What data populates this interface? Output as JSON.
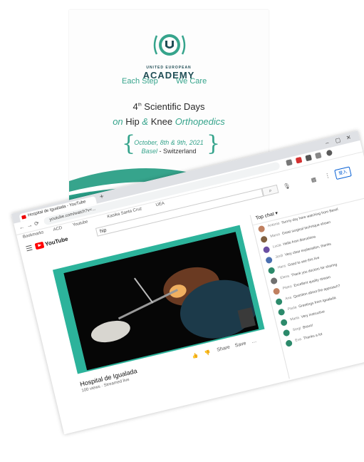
{
  "poster": {
    "logo_line1": "UNITED EUROPEAN",
    "logo_line2": "ACADEMY",
    "tagline_left": "Each Step",
    "tagline_right": "We Care",
    "title_line1_prefix": "4",
    "title_line1_sup": "th",
    "title_line1_rest": " Scientific Days",
    "title_line2_on": "on ",
    "title_line2_hip": "Hip ",
    "title_line2_amp": "& ",
    "title_line2_knee": "Knee ",
    "title_line2_ortho": "Orthopedics",
    "date_line1": "October, 8th & 9th, 2021",
    "date_line2_city": "Basel",
    "date_line2_rest": " - Switzerland",
    "colors": {
      "accent": "#36a48c",
      "navy": "#1f4d55"
    }
  },
  "browser": {
    "tab_title": "Hospital de Igualada - YouTube",
    "url": "youtube.com/watch?v=...",
    "bookmarks": [
      "Bookmarks",
      "ACD",
      "Youtube",
      "Kasika Santa Cruz",
      "UEA"
    ],
    "youtube": {
      "logo_text": "YouTube",
      "search_value": "hip",
      "login_label": "登入",
      "video_title": "Hospital de Igualada",
      "video_meta": "100 views · Streamed live",
      "actions": [
        "👍",
        "👎",
        "Share",
        "Save",
        "…"
      ],
      "chat_header": "Top chat ▾",
      "chat": [
        {
          "author": "Antonio",
          "text": "Sunny day here watching from Basel",
          "color": "#c08060"
        },
        {
          "author": "Marco",
          "text": "Great surgical technique shown",
          "color": "#806040"
        },
        {
          "author": "Lucia",
          "text": "Hello from Barcelona",
          "color": "#6a4fa3"
        },
        {
          "author": "Jordi",
          "text": "Very clear explanation, thanks",
          "color": "#4a6fb0"
        },
        {
          "author": "Hans",
          "text": "Good to see this live",
          "color": "#2c8a6b"
        },
        {
          "author": "Elena",
          "text": "Thank you doctors for sharing",
          "color": "#707070"
        },
        {
          "author": "Pietro",
          "text": "Excellent quality stream",
          "color": "#c08060"
        },
        {
          "author": "Ana",
          "text": "Question about the approach?",
          "color": "#2c8a6b"
        },
        {
          "author": "Paula",
          "text": "Greetings from Igualada",
          "color": "#2c8a6b"
        },
        {
          "author": "Marta",
          "text": "Very instructive",
          "color": "#2c8a6b"
        },
        {
          "author": "Sergi",
          "text": "Bravo!",
          "color": "#2c8a6b"
        },
        {
          "author": "Eva",
          "text": "Thanks a lot",
          "color": "#2c8a6b"
        }
      ]
    }
  }
}
